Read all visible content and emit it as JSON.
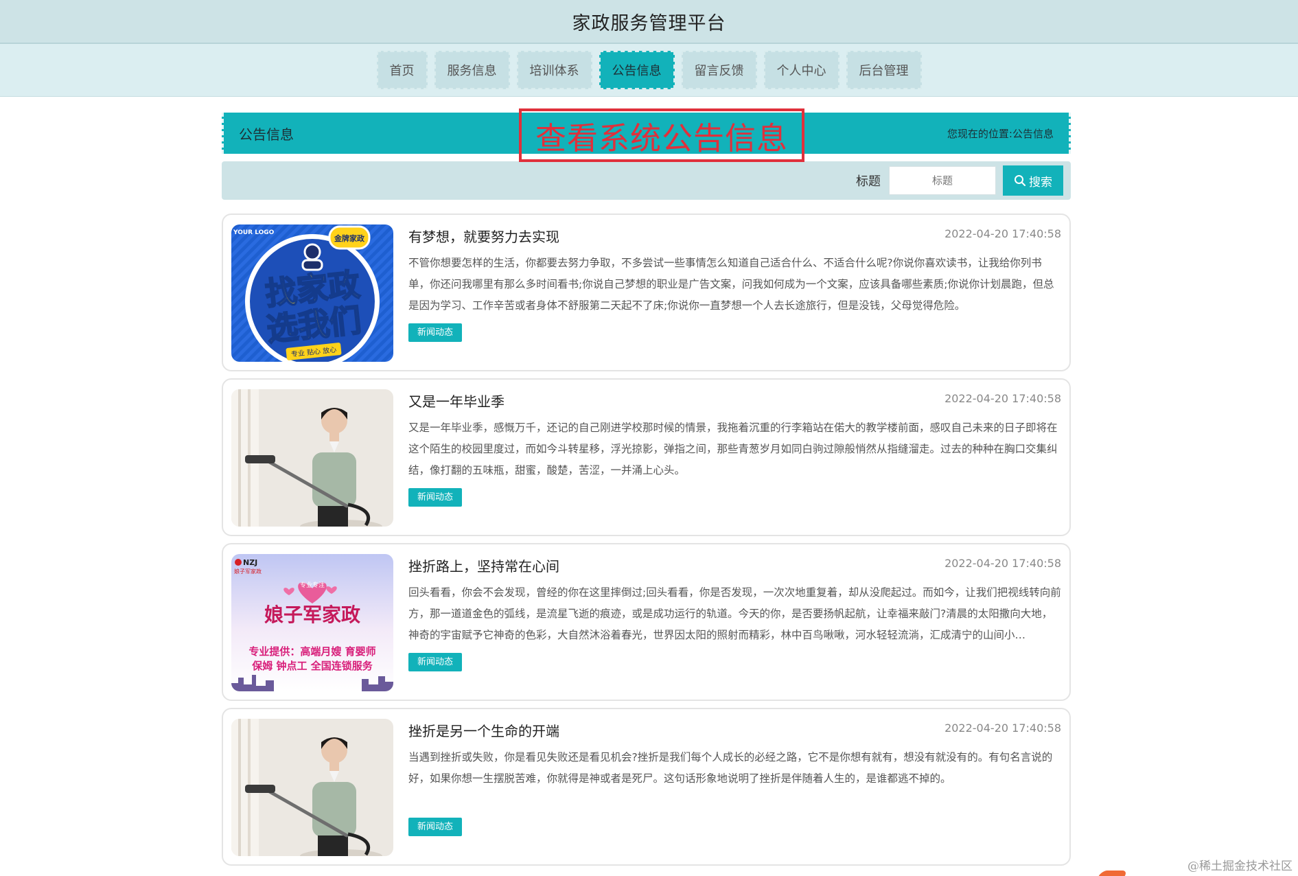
{
  "header": {
    "title": "家政服务管理平台"
  },
  "nav": {
    "items": [
      {
        "label": "首页",
        "active": false
      },
      {
        "label": "服务信息",
        "active": false
      },
      {
        "label": "培训体系",
        "active": false
      },
      {
        "label": "公告信息",
        "active": true
      },
      {
        "label": "留言反馈",
        "active": false
      },
      {
        "label": "个人中心",
        "active": false
      },
      {
        "label": "后台管理",
        "active": false
      }
    ]
  },
  "breadcrumb": {
    "section": "公告信息",
    "location_prefix": "您现在的位置:",
    "location": "公告信息"
  },
  "annotation": {
    "text": "查看系统公告信息"
  },
  "search": {
    "label": "标题",
    "placeholder": "标题",
    "button_label": "搜索"
  },
  "announcements": [
    {
      "title": "有梦想，就要努力去实现",
      "date": "2022-04-20 17:40:58",
      "body": "不管你想要怎样的生活，你都要去努力争取，不多尝试一些事情怎么知道自己适合什么、不适合什么呢?你说你喜欢读书，让我给你列书单，你还问我哪里有那么多时间看书;你说自己梦想的职业是广告文案，问我如何成为一个文案，应该具备哪些素质;你说你计划晨跑，但总是因为学习、工作辛苦或者身体不舒服第二天起不了床;你说你一直梦想一个人去长途旅行，但是没钱，父母觉得危险。",
      "tag": "新闻动态",
      "image": "poster-blue",
      "image_texts": {
        "logo": "YOUR LOGO",
        "badge": "金牌家政",
        "line1": "找家政",
        "line2": "选我们",
        "ribbon": "专业 贴心 放心"
      }
    },
    {
      "title": "又是一年毕业季",
      "date": "2022-04-20 17:40:58",
      "body": "又是一年毕业季，感慨万千，还记的自己刚进学校那时候的情景，我拖着沉重的行李箱站在偌大的教学楼前面，感叹自己未来的日子即将在这个陌生的校园里度过，而如今斗转星移，浮光掠影，弹指之间，那些青葱岁月如同白驹过隙般悄然从指缝溜走。过去的种种在胸口交集纠结，像打翻的五味瓶，甜蜜，酸楚，苦涩，一并涌上心头。",
      "tag": "新闻动态",
      "image": "photo-cleaner"
    },
    {
      "title": "挫折路上，坚持常在心间",
      "date": "2022-04-20 17:40:58",
      "body": "回头看看，你会不会发现，曾经的你在这里摔倒过;回头看看，你是否发现，一次次地重复着，却从没爬起过。而如今，让我们把视线转向前方，那一道道金色的弧线，是流星飞逝的痕迹，或是成功运行的轨道。今天的你，是否要扬帆起航，让幸福来敲门?清晨的太阳撒向大地，神奇的宇宙赋予它神奇的色彩，大自然沐浴着春光，世界因太阳的照射而精彩，林中百鸟啾啾，河水轻轻流淌，汇成清宁的山间小…",
      "tag": "新闻动态",
      "image": "poster-pink",
      "image_texts": {
        "brand": "NZJ",
        "brand_sub": "娘子军家政",
        "heart": "专业专注",
        "main": "娘子军家政",
        "line1": "专业提供：高端月嫂 育婴师",
        "line2": "保姆 钟点工 全国连锁服务"
      }
    },
    {
      "title": "挫折是另一个生命的开端",
      "date": "2022-04-20 17:40:58",
      "body": "当遇到挫折或失败，你是看见失败还是看见机会?挫折是我们每个人成长的必经之路，它不是你想有就有，想没有就没有的。有句名言说的好，如果你想一生摆脱苦难，你就得是神或者是死尸。这句话形象地说明了挫折是伴随着人生的，是谁都逃不掉的。",
      "tag": "新闻动态",
      "image": "photo-cleaner"
    }
  ],
  "watermark": "@稀土掘金技术社区",
  "colors": {
    "accent": "#12b2ba",
    "header_bg": "#cde3e6",
    "annotation": "#e0303b"
  }
}
